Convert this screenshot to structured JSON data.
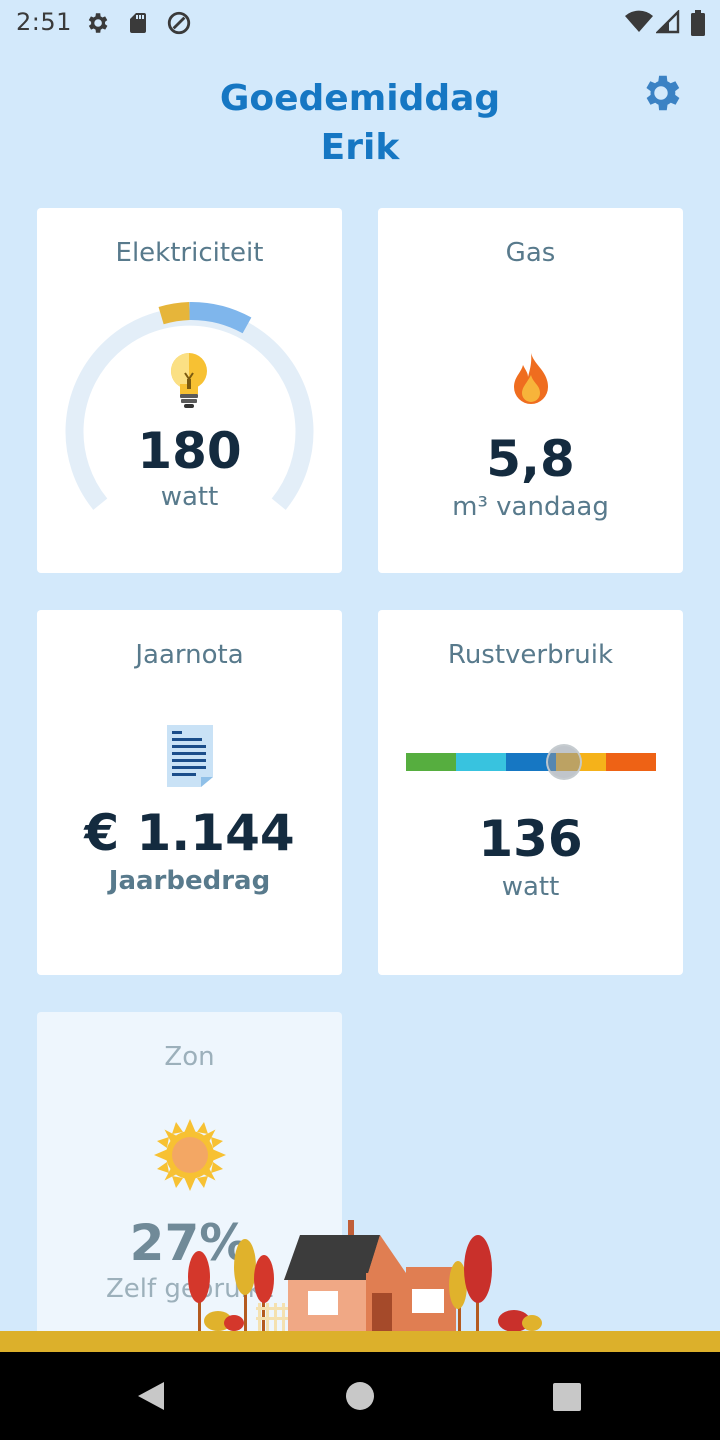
{
  "status_bar": {
    "time": "2:51",
    "left_icons": [
      "gear-icon",
      "sd-card-icon",
      "data-saver-icon"
    ],
    "right_icons": [
      "wifi-icon",
      "signal-icon",
      "battery-icon"
    ]
  },
  "header": {
    "greeting_line1": "Goedemiddag",
    "greeting_line2": "Erik",
    "settings_icon": "gear-icon"
  },
  "cards": {
    "electricity": {
      "title": "Elektriciteit",
      "value": "180",
      "unit": "watt",
      "icon": "lightbulb-icon",
      "gauge_colors": [
        "#e6b53a",
        "#7fb6ec"
      ]
    },
    "gas": {
      "title": "Gas",
      "value": "5,8",
      "unit": "m³ vandaag",
      "icon": "flame-icon"
    },
    "annual_bill": {
      "title": "Jaarnota",
      "value": "€ 1.144",
      "unit": "Jaarbedrag",
      "icon": "document-icon"
    },
    "base_load": {
      "title": "Rustverbruik",
      "value": "136",
      "unit": "watt",
      "scale_colors": [
        "#56ae3f",
        "#38c3df",
        "#1677c3",
        "#f5b21a",
        "#ee6215"
      ],
      "indicator_position": 0.63
    },
    "solar": {
      "title": "Zon",
      "value": "27%",
      "unit": "Zelf gebruikt",
      "icon": "sun-icon"
    }
  },
  "nav": {
    "back": "back-icon",
    "home": "home-icon",
    "recents": "recents-icon"
  },
  "colors": {
    "background": "#d3e9fb",
    "accent": "#1677c3",
    "ground": "#dcb02b"
  }
}
